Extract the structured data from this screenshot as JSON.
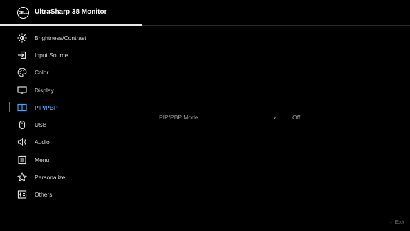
{
  "header": {
    "logo_text": "DELL",
    "title": "UltraSharp 38 Monitor"
  },
  "menu": {
    "items": [
      {
        "label": "Brightness/Contrast",
        "icon": "brightness-icon"
      },
      {
        "label": "Input Source",
        "icon": "input-source-icon"
      },
      {
        "label": "Color",
        "icon": "color-palette-icon"
      },
      {
        "label": "Display",
        "icon": "display-icon"
      },
      {
        "label": "PIP/PBP",
        "icon": "pip-pbp-icon",
        "active": true
      },
      {
        "label": "USB",
        "icon": "usb-mouse-icon"
      },
      {
        "label": "Audio",
        "icon": "speaker-icon"
      },
      {
        "label": "Menu",
        "icon": "menu-list-icon"
      },
      {
        "label": "Personalize",
        "icon": "star-icon"
      },
      {
        "label": "Others",
        "icon": "others-icon"
      }
    ]
  },
  "submenu": {
    "item_label": "PIP/PBP Mode",
    "chevron": "›",
    "item_value": "Off"
  },
  "footer": {
    "back_glyph": "‹",
    "exit_label": "Exit"
  },
  "colors": {
    "accent": "#1e88e5",
    "active_text": "#4aa3e8",
    "background": "#000000"
  }
}
